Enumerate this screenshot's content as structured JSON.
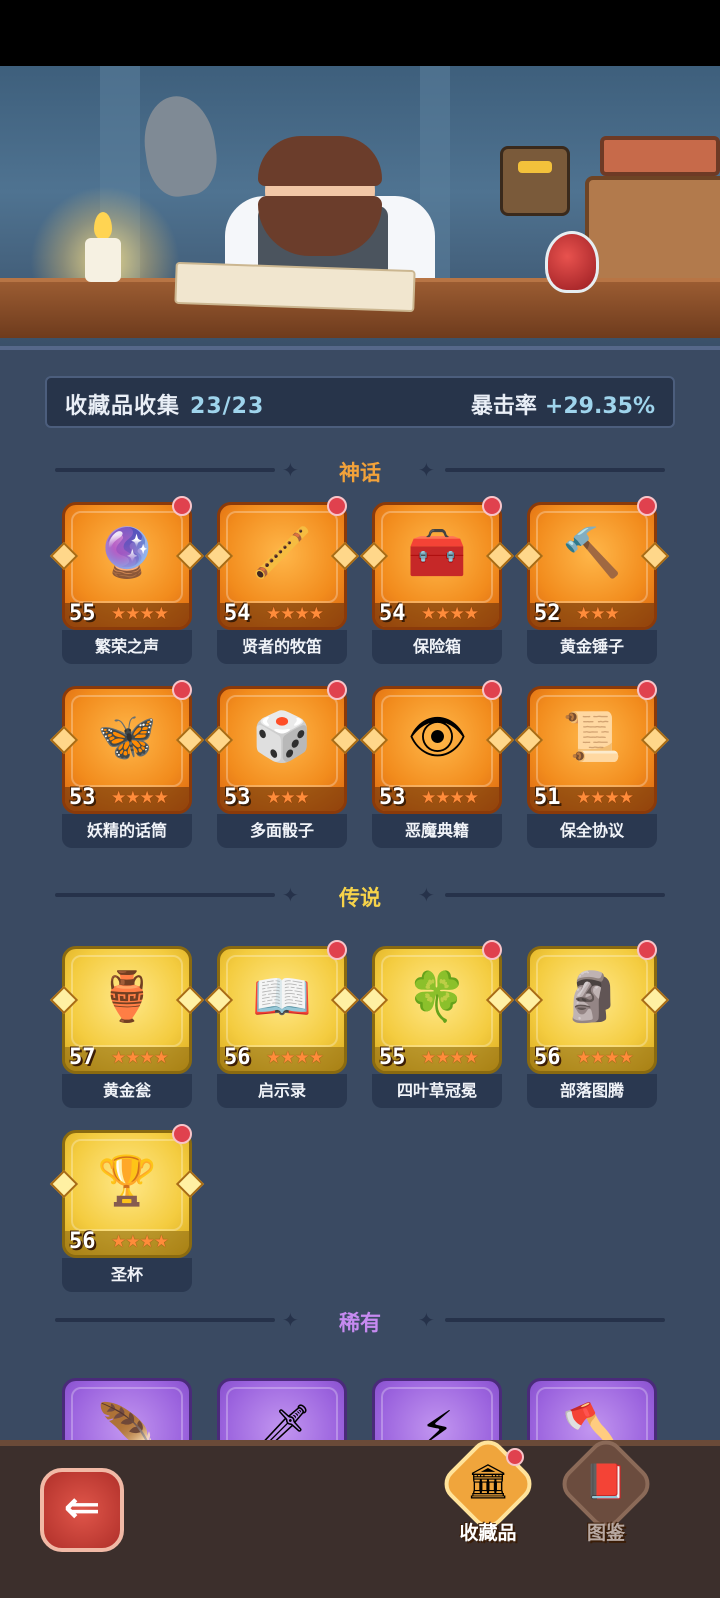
{
  "summary": {
    "collection_label": "收藏品收集",
    "collection_count": "23/23",
    "crit_label": "暴击率",
    "crit_value": "+29.35%"
  },
  "sections": {
    "mythic": {
      "title": "神话",
      "color": "#f2a23a"
    },
    "legendary": {
      "title": "传说",
      "color": "#f6d34a"
    },
    "rare": {
      "title": "稀有",
      "color": "#c68af0"
    }
  },
  "mythic_items": [
    {
      "name": "繁荣之声",
      "level": "55",
      "stars": 4,
      "icon": "voice-orb-icon"
    },
    {
      "name": "贤者的牧笛",
      "level": "54",
      "stars": 4,
      "icon": "flute-icon"
    },
    {
      "name": "保险箱",
      "level": "54",
      "stars": 4,
      "icon": "treasure-chest-icon"
    },
    {
      "name": "黄金锤子",
      "level": "52",
      "stars": 3,
      "icon": "hammer-icon"
    },
    {
      "name": "妖精的话筒",
      "level": "53",
      "stars": 4,
      "icon": "fairy-microphone-icon"
    },
    {
      "name": "多面骰子",
      "level": "53",
      "stars": 3,
      "icon": "dice-icon"
    },
    {
      "name": "恶魔典籍",
      "level": "53",
      "stars": 4,
      "icon": "demon-book-icon"
    },
    {
      "name": "保全协议",
      "level": "51",
      "stars": 4,
      "icon": "contract-scroll-icon"
    }
  ],
  "legendary_items": [
    {
      "name": "黄金瓮",
      "level": "57",
      "stars": 4,
      "icon": "golden-urn-icon"
    },
    {
      "name": "启示录",
      "level": "56",
      "stars": 4,
      "icon": "open-book-icon"
    },
    {
      "name": "四叶草冠冕",
      "level": "55",
      "stars": 4,
      "icon": "clover-crown-icon"
    },
    {
      "name": "部落图腾",
      "level": "56",
      "stars": 4,
      "icon": "tribal-totem-icon"
    },
    {
      "name": "圣杯",
      "level": "56",
      "stars": 4,
      "icon": "holy-grail-icon"
    }
  ],
  "rare_items": [
    {
      "icon": "phoenix-feather-icon"
    },
    {
      "icon": "ice-sword-icon"
    },
    {
      "icon": "lightning-rune-icon"
    },
    {
      "icon": "axe-icon"
    }
  ],
  "nav": {
    "collection_label": "收藏品",
    "codex_label": "图鉴",
    "back_icon": "back-arrow-icon"
  }
}
